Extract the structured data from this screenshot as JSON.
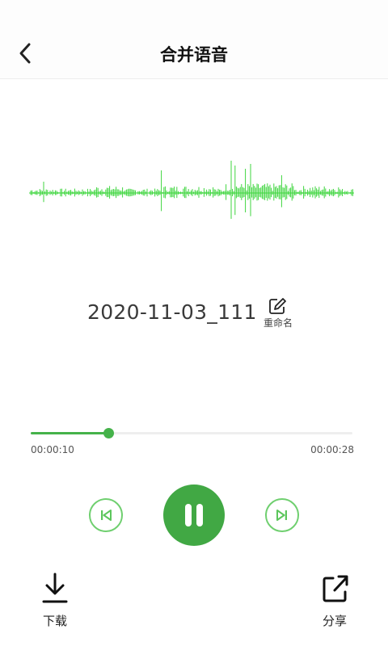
{
  "header": {
    "title": "合并语音",
    "back_icon": "chevron-left-icon"
  },
  "recording": {
    "filename": "2020-11-03_111",
    "rename_label": "重命名",
    "rename_icon": "edit-icon"
  },
  "playback": {
    "current_time": "00:00:10",
    "total_time": "00:00:28",
    "progress_fraction": 0.24,
    "state": "playing"
  },
  "actions": {
    "download_label": "下载",
    "share_label": "分享"
  },
  "colors": {
    "accent": "#41a844",
    "waveform": "#3fd63f",
    "control_outline": "#6fcf6f"
  }
}
